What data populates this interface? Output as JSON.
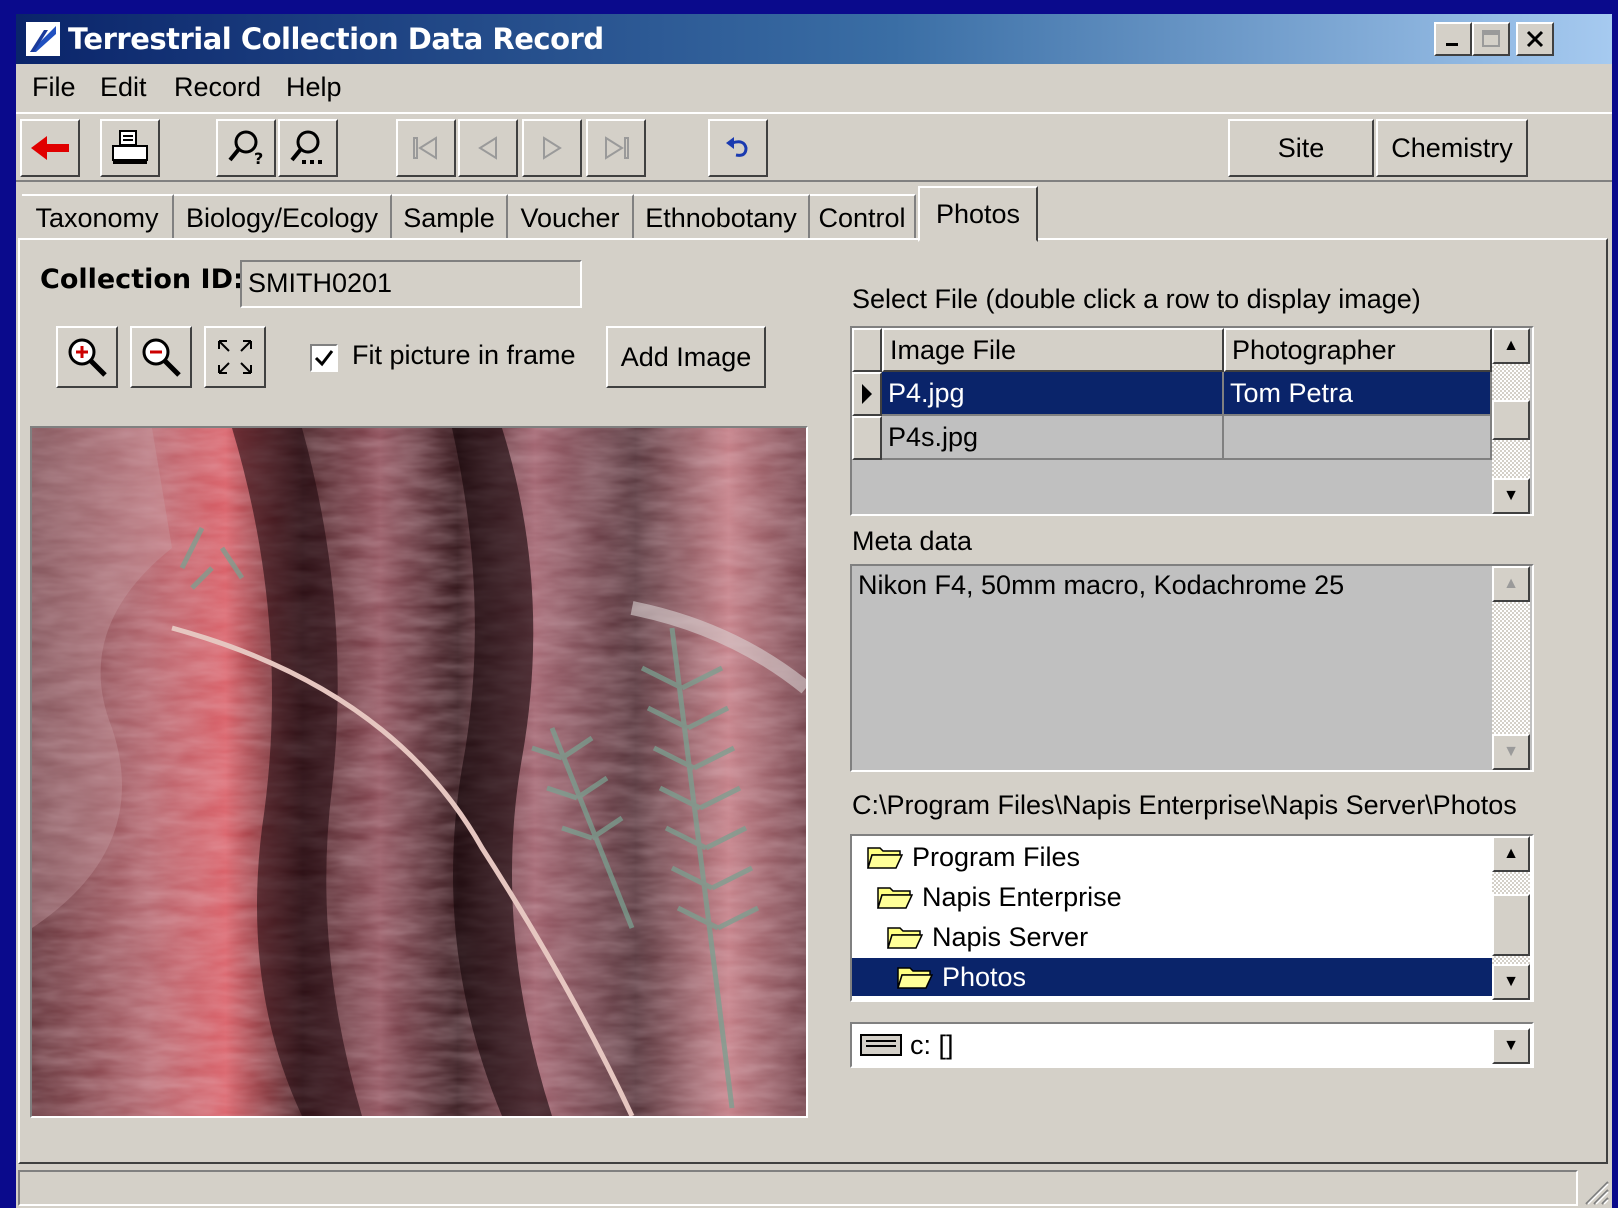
{
  "window": {
    "title": "Terrestrial Collection Data Record",
    "controls": [
      "_",
      "□",
      "×"
    ]
  },
  "menu": [
    "File",
    "Edit",
    "Record",
    "Help"
  ],
  "toolbar": {
    "icons": [
      "back-arrow-icon",
      "print-icon",
      "find-icon",
      "find-next-icon",
      "first-record-icon",
      "previous-record-icon",
      "next-record-icon",
      "last-record-icon",
      "undo-icon"
    ],
    "site_label": "Site",
    "chemistry_label": "Chemistry"
  },
  "tabs": [
    "Taxonomy",
    "Biology/Ecology",
    "Sample",
    "Voucher",
    "Ethnobotany",
    "Control",
    "Photos"
  ],
  "active_tab": "Photos",
  "collection": {
    "label": "Collection ID:",
    "value": "SMITH0201"
  },
  "image_controls": {
    "fit_label": "Fit picture in frame",
    "fit_checked": true,
    "add_image_label": "Add Image"
  },
  "file_grid": {
    "caption": "Select File (double click a row to display image)",
    "columns": [
      "Image File",
      "Photographer"
    ],
    "rows": [
      {
        "file": "P4.jpg",
        "photographer": "Tom Petra",
        "selected": true
      },
      {
        "file": "P4s.jpg",
        "photographer": "",
        "selected": false
      }
    ]
  },
  "metadata": {
    "label": "Meta data",
    "text": "Nikon F4, 50mm macro, Kodachrome 25"
  },
  "folders": {
    "path": "C:\\Program Files\\Napis Enterprise\\Napis Server\\Photos",
    "items": [
      "Program Files",
      "Napis Enterprise",
      "Napis Server",
      "Photos"
    ],
    "selected": "Photos"
  },
  "drive": {
    "value": "c: []"
  },
  "colors": {
    "selection": "#0a246a",
    "face": "#d4d0c8",
    "desktop": "#0a0a8c"
  }
}
